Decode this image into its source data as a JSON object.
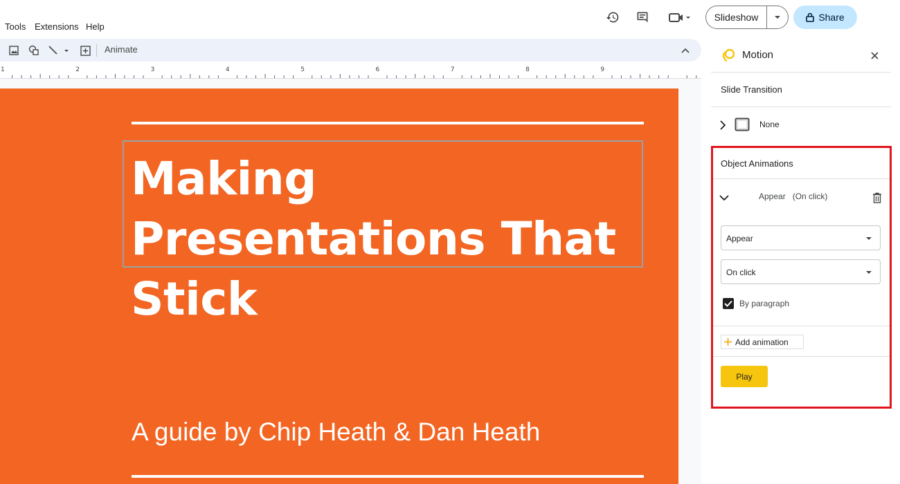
{
  "menu": {
    "tools": "Tools",
    "extensions": "Extensions",
    "help": "Help"
  },
  "header": {
    "slideshow_label": "Slideshow",
    "share_label": "Share"
  },
  "toolbar": {
    "animate_label": "Animate"
  },
  "ruler": {
    "marks": [
      "1",
      "2",
      "3",
      "4",
      "5",
      "6",
      "7",
      "8",
      "9"
    ]
  },
  "slide": {
    "title_lines": [
      "Making",
      "Presentations That",
      "Stick"
    ],
    "subtitle": "A guide by Chip Heath & Dan Heath",
    "background_color": "#f26522"
  },
  "panel": {
    "title": "Motion",
    "slide_transition_label": "Slide Transition",
    "transition_value": "None",
    "object_animations_label": "Object Animations",
    "animation_summary": "Appear   (On click)",
    "effect_select": "Appear",
    "trigger_select": "On click",
    "by_paragraph_label": "By paragraph",
    "by_paragraph_checked": true,
    "add_animation_label": "Add animation",
    "play_label": "Play",
    "highlight_color": "#e1141b",
    "play_color": "#f6c50e"
  }
}
